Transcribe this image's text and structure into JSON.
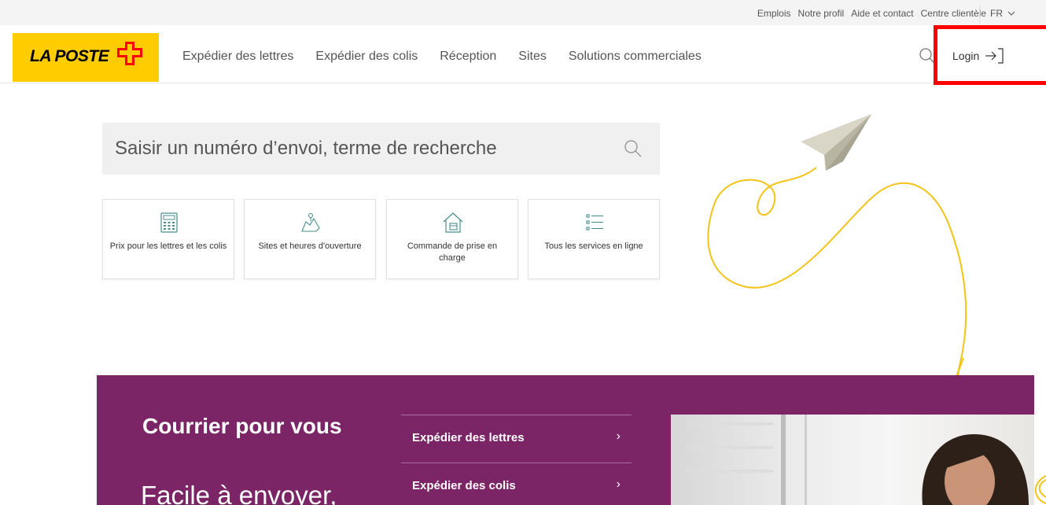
{
  "utility": {
    "links": [
      "Emplois",
      "Notre profil",
      "Aide et contact",
      "Centre clientèle"
    ],
    "language": "FR"
  },
  "header": {
    "logo_text": "LA POSTE",
    "nav": [
      "Expédier des lettres",
      "Expédier des colis",
      "Réception",
      "Sites",
      "Solutions commerciales"
    ],
    "login_label": "Login"
  },
  "search": {
    "placeholder": "Saisir un numéro d’envoi, terme de recherche"
  },
  "tiles": [
    {
      "label": "Prix pour les lettres et les colis",
      "icon": "calculator-icon"
    },
    {
      "label": "Sites et heures d'ouverture",
      "icon": "location-icon"
    },
    {
      "label": "Commande de prise en charge",
      "icon": "house-parcel-icon"
    },
    {
      "label": "Tous les services en ligne",
      "icon": "list-icon"
    }
  ],
  "teaser": {
    "title": "Courrier pour vous",
    "subtitle": "Facile à envoyer,",
    "links": [
      "Expédier des lettres",
      "Expédier des colis"
    ]
  },
  "colors": {
    "brand_yellow": "#ffcc00",
    "teaser_purple": "#7b2466",
    "highlight_red": "#ff0000",
    "icon_teal": "#4a8c8c"
  }
}
